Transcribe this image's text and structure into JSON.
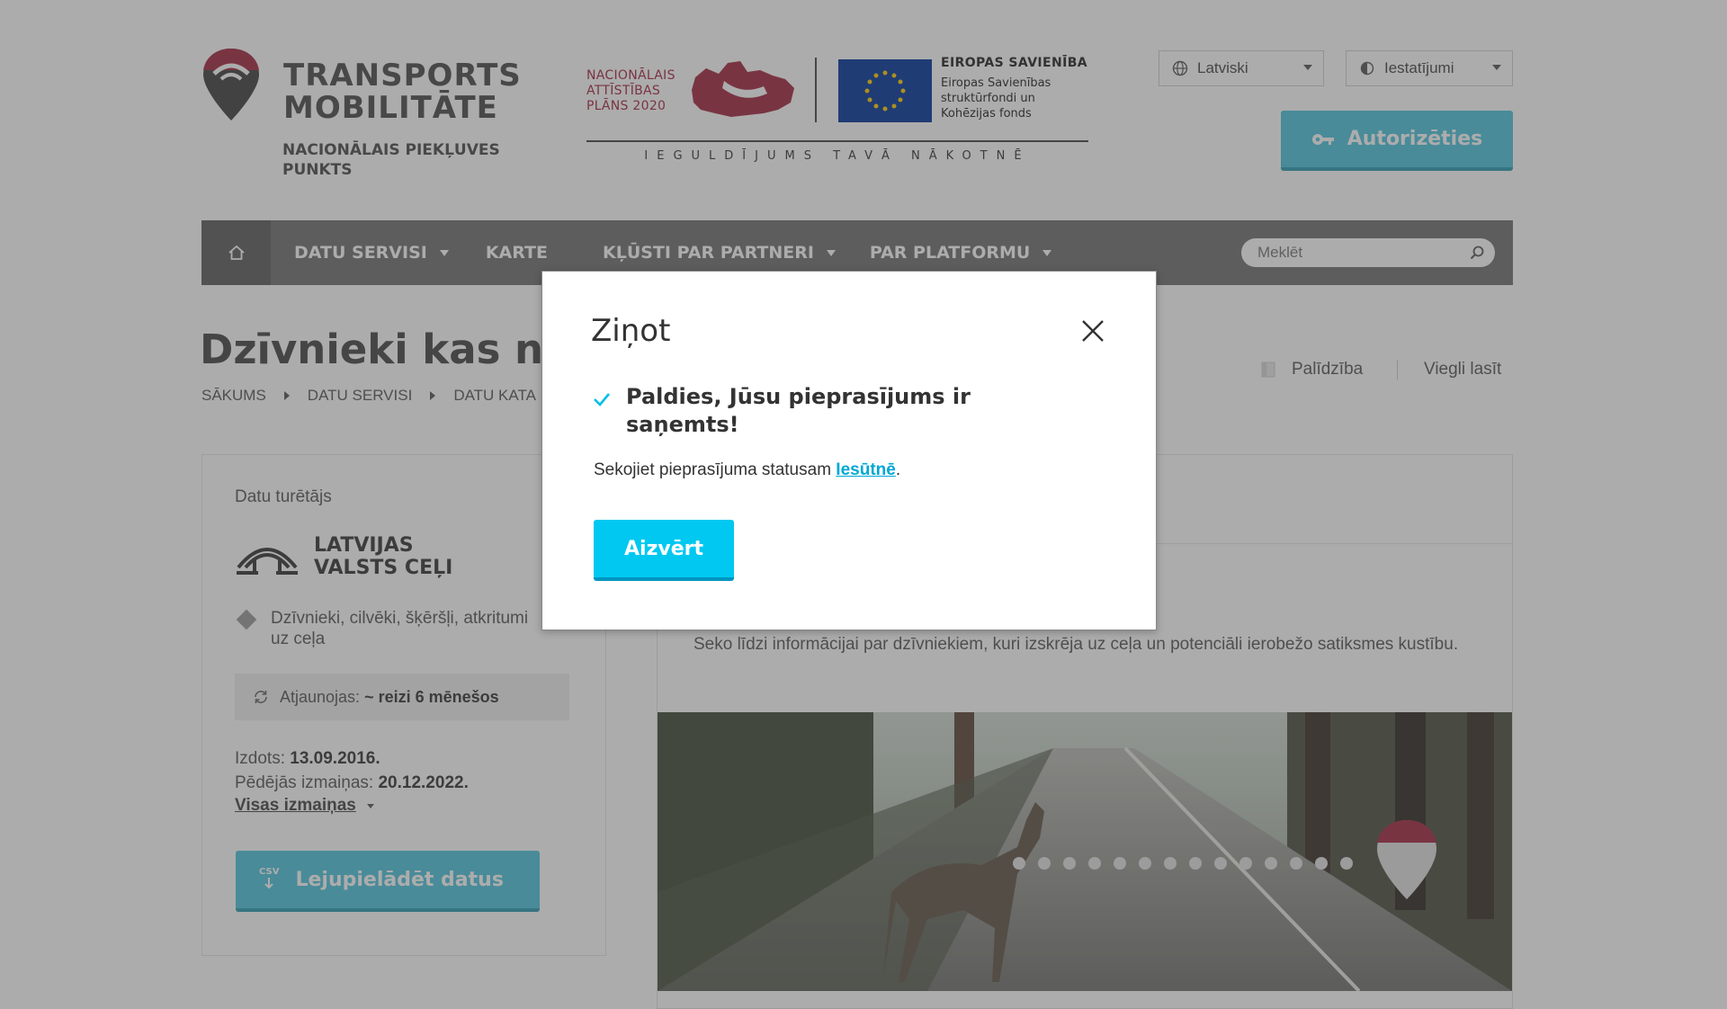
{
  "header": {
    "logo_title_line1": "TRANSPORTS",
    "logo_title_line2": "MOBILITĀTE",
    "logo_subtitle": "NACIONĀLAIS PIEKĻUVES PUNKTS",
    "nap_line1": "NACIONĀLAIS",
    "nap_line2": "ATTĪSTĪBAS",
    "nap_line3": "PLĀNS 2020",
    "eu_title": "EIROPAS SAVIENĪBA",
    "eu_line1": "Eiropas Savienības",
    "eu_line2": "struktūrfondi un",
    "eu_line3": "Kohēzijas fonds",
    "motto": "IEGULDĪJUMS TAVĀ NĀKOTNĒ",
    "language_select": "Latviski",
    "settings_select": "Iestatījumi",
    "login_button": "Autorizēties"
  },
  "nav": {
    "items": [
      {
        "label": "DATU SERVISI"
      },
      {
        "label": "KARTE"
      },
      {
        "label": "KĻŪSTI PAR PARTNERI"
      },
      {
        "label": "PAR PLATFORMU"
      }
    ],
    "search_placeholder": "Meklēt"
  },
  "page": {
    "title": "Dzīvnieki kas no",
    "breadcrumbs": [
      "SĀKUMS",
      "DATU SERVISI",
      "DATU KATA"
    ],
    "help": "Palīdzība",
    "easy_read": "Viegli lasīt"
  },
  "left_card": {
    "holder_label": "Datu turētājs",
    "holder_line1": "LATVIJAS",
    "holder_line2": "VALSTS CEĻI",
    "category": "Dzīvnieki, cilvēki, šķēršļi, atkritumi uz ceļa",
    "update_label": "Atjaunojas:",
    "update_value": "~ reizi 6 mēnešos",
    "published_label": "Izdots:",
    "published_value": "13.09.2016.",
    "modified_label": "Pēdējās izmaiņas:",
    "modified_value": "20.12.2022.",
    "all_changes": "Visas izmaiņas",
    "csv_label": "CSV",
    "download_button": "Lejupielādēt datus"
  },
  "right_card": {
    "description": "Seko līdzi informācijai par dzīvniekiem, kuri izskrēja uz ceļa un potenciāli ierobežo satiksmes kustību."
  },
  "modal": {
    "title": "Ziņot",
    "heading": "Paldies, Jūsu pieprasījums ir saņemts!",
    "text_before": "Sekojiet pieprasījuma statusam ",
    "link": "Iesūtnē",
    "text_after": ".",
    "close_button": "Aizvērt"
  },
  "colors": {
    "accent": "#00c8f0",
    "brand_red": "#a3263e",
    "nav_bg": "#6f6f6f"
  }
}
